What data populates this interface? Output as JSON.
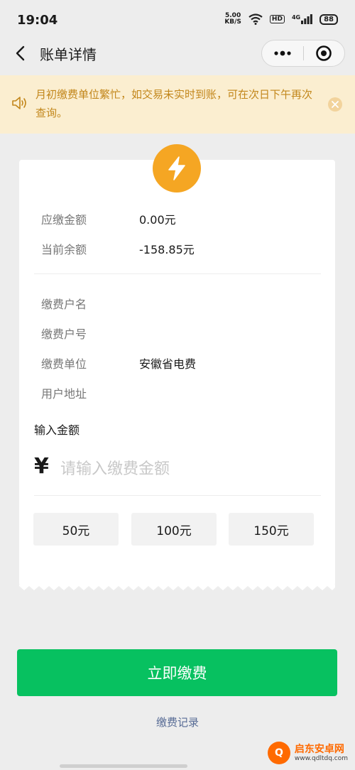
{
  "status_bar": {
    "time": "19:04",
    "speed_value": "5.00",
    "speed_unit": "KB/S",
    "hd": "HD",
    "network": "4G",
    "battery": "88"
  },
  "nav": {
    "title": "账单详情",
    "back_icon": "chevron-left-icon",
    "more_icon": "more-dots-icon",
    "close_icon": "target-circle-icon"
  },
  "notice": {
    "text": "月初缴费单位繁忙，如交易未实时到账，可在次日下午再次查询。",
    "icon": "speaker-icon",
    "close_icon": "close-circle-icon",
    "color": "#c2861a",
    "background": "#fbeed0"
  },
  "bill": {
    "icon": "lightning-icon",
    "icon_color": "#f5a623",
    "rows_top": [
      {
        "label": "应缴金额",
        "value": "0.00元"
      },
      {
        "label": "当前余额",
        "value": "-158.85元"
      }
    ],
    "rows_bottom": [
      {
        "label": "缴费户名",
        "value": ""
      },
      {
        "label": "缴费户号",
        "value": ""
      },
      {
        "label": "缴费单位",
        "value": "安徽省电费"
      },
      {
        "label": "用户地址",
        "value": ""
      }
    ]
  },
  "amount_input": {
    "title": "输入金额",
    "currency": "¥",
    "placeholder": "请输入缴费金额",
    "value": ""
  },
  "quick_amounts": [
    "50元",
    "100元",
    "150元"
  ],
  "actions": {
    "pay_label": "立即缴费",
    "pay_color": "#07c160",
    "history_label": "缴费记录"
  },
  "watermark": {
    "title": "启东安卓网",
    "url": "www.qdltdq.com"
  }
}
